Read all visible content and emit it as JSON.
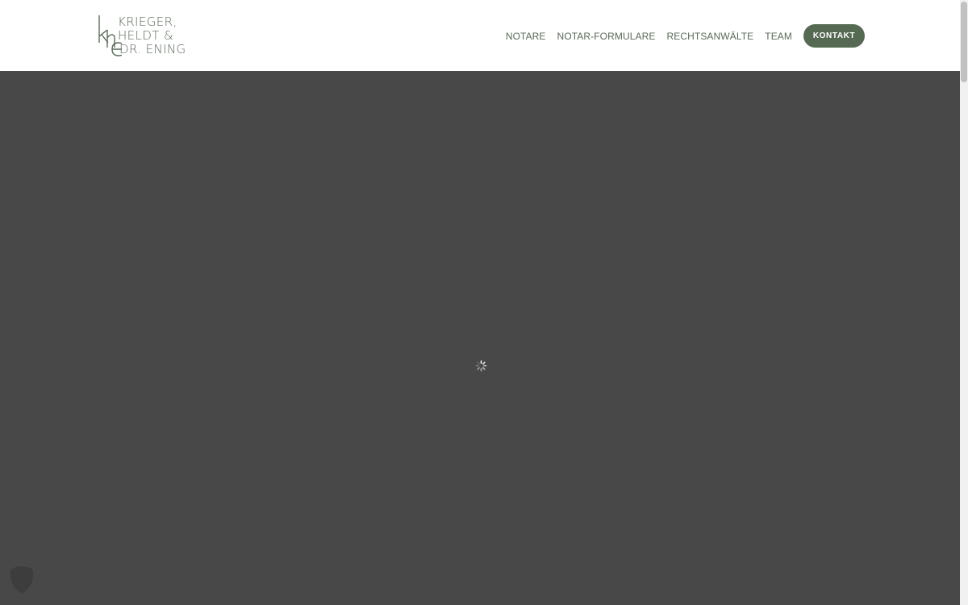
{
  "header": {
    "logo": {
      "monogram": "khe",
      "lines": [
        "KRIEGER,",
        "HELDT &",
        "DR. ENING"
      ]
    },
    "nav": [
      {
        "label": "NOTARE"
      },
      {
        "label": "NOTAR-FORMULARE"
      },
      {
        "label": "RECHTSANWÄLTE"
      },
      {
        "label": "TEAM"
      }
    ],
    "cta_label": "KONTAKT"
  },
  "hero": {
    "state_icon": "loading-spinner-icon"
  },
  "cookie_widget": {
    "icon": "shield-icon"
  },
  "colors": {
    "brand": "#566a53",
    "text": "#5a6b58",
    "hero_bg": "#484848"
  }
}
